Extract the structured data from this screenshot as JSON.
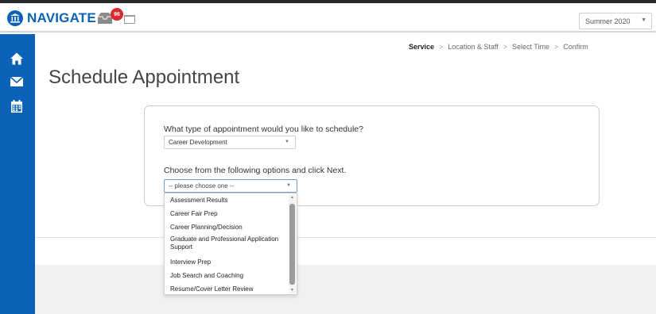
{
  "app": {
    "name": "NAVIGATE",
    "brand_color": "#0a62b8"
  },
  "header": {
    "notification_count": "96",
    "term_select": {
      "value": "Summer 2020"
    }
  },
  "sidebar": {
    "items": [
      {
        "icon": "home-icon"
      },
      {
        "icon": "mail-icon"
      },
      {
        "icon": "calendar-icon"
      }
    ]
  },
  "steps": [
    {
      "label": "Service",
      "active": true
    },
    {
      "label": "Location & Staff",
      "active": false
    },
    {
      "label": "Select Time",
      "active": false
    },
    {
      "label": "Confirm",
      "active": false
    }
  ],
  "step_separator": ">",
  "page": {
    "title": "Schedule Appointment"
  },
  "form": {
    "question1": "What type of appointment would you like to schedule?",
    "type_select": {
      "value": "Career Development"
    },
    "question2": "Choose from the following options and click Next.",
    "option_select": {
      "value": "-- please choose one --"
    }
  },
  "dropdown": {
    "options": [
      "Assessment Results",
      "Career Fair Prep",
      "Career Planning/Decision",
      "Graduate and Professional Application Support",
      "Interview Prep",
      "Job Search and Coaching",
      "Resume/Cover Letter Review"
    ]
  }
}
